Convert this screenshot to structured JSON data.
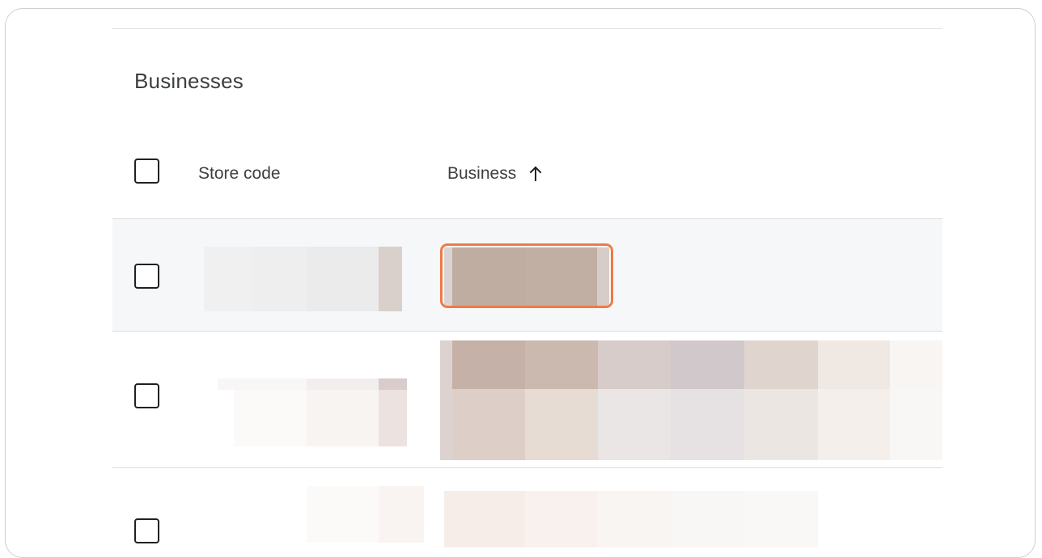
{
  "section": {
    "title": "Businesses"
  },
  "table": {
    "columns": [
      {
        "label": "Store code",
        "sortable": false
      },
      {
        "label": "Business",
        "sortable": true,
        "sort_direction": "ascending"
      }
    ],
    "rows": [
      {
        "selected": false,
        "store_code": "",
        "business": "",
        "highlighted": true
      },
      {
        "selected": false,
        "store_code": "",
        "business": "",
        "highlighted": false
      },
      {
        "selected": false,
        "store_code": "",
        "business": "",
        "highlighted": false
      }
    ]
  },
  "colors": {
    "highlight": "#f07a45",
    "row_hover_bg": "#f6f7f9",
    "divider": "#dadce0"
  }
}
